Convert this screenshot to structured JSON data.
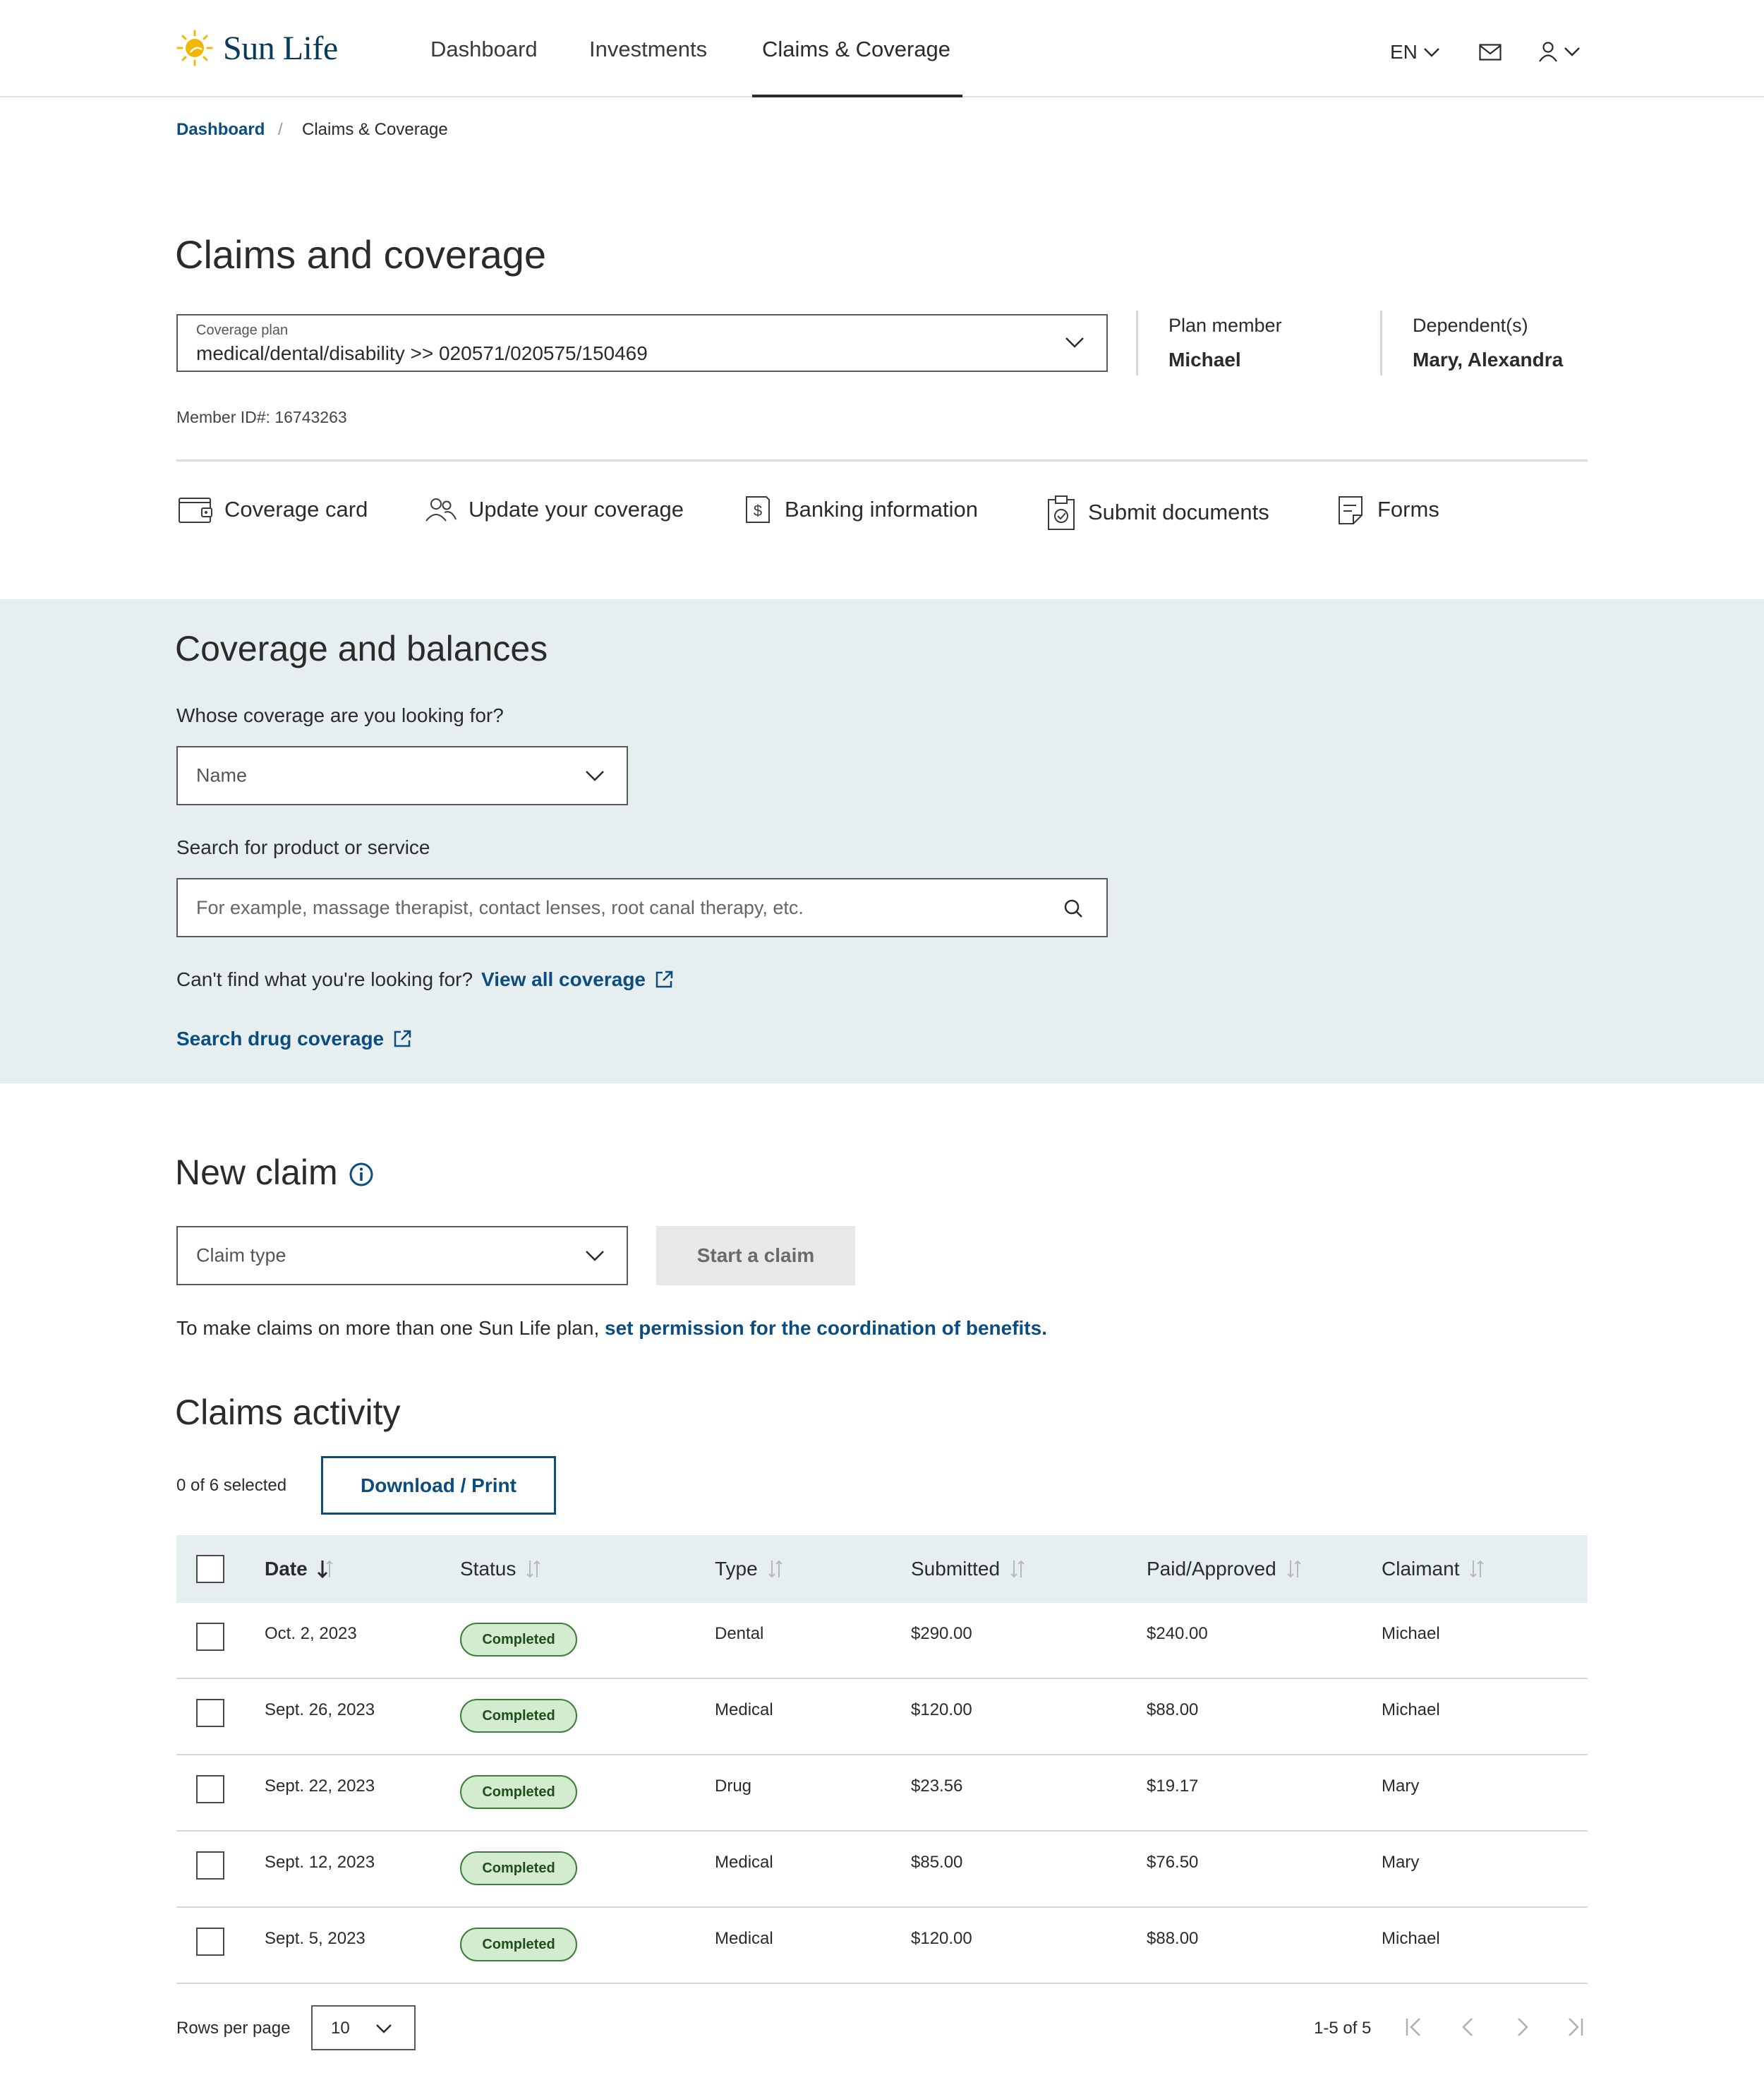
{
  "header": {
    "logo_text": "Sun Life",
    "nav": [
      "Dashboard",
      "Investments",
      "Claims & Coverage"
    ],
    "active_nav": "Claims & Coverage",
    "language": "EN"
  },
  "breadcrumb": {
    "parent": "Dashboard",
    "separator": "/",
    "current": "Claims & Coverage"
  },
  "page": {
    "title": "Claims and coverage",
    "coverage_plan_label": "Coverage plan",
    "coverage_plan_value": "medical/dental/disability >> 020571/020575/150469",
    "plan_member_label": "Plan member",
    "plan_member_value": "Michael",
    "dependents_label": "Dependent(s)",
    "dependents_value": "Mary, Alexandra",
    "member_id": "Member ID#: 16743263"
  },
  "quick_links": [
    {
      "label": "Coverage card",
      "icon": "wallet-card-icon"
    },
    {
      "label": "Update your coverage",
      "icon": "people-icon"
    },
    {
      "label": "Banking information",
      "icon": "dollar-document-icon"
    },
    {
      "label": "Submit documents",
      "icon": "clipboard-check-icon"
    },
    {
      "label": "Forms",
      "icon": "form-icon"
    }
  ],
  "coverage": {
    "title": "Coverage and balances",
    "whose_label": "Whose coverage are you looking for?",
    "name_select": "Name",
    "search_label": "Search for product or service",
    "search_placeholder": "For example, massage therapist, contact lenses, root canal therapy, etc.",
    "cant_find": "Can't find what you're looking for?",
    "view_all": "View all coverage",
    "drug_link": "Search drug coverage"
  },
  "new_claim": {
    "title": "New claim",
    "claim_type": "Claim type",
    "start_button": "Start a claim",
    "permission_text": "To make claims on more than one Sun Life plan,",
    "permission_link": "set permission for the coordination of benefits."
  },
  "claims_activity": {
    "title": "Claims activity",
    "selected_count": "0 of 6 selected",
    "download_button": "Download / Print",
    "columns": [
      "Date",
      "Status",
      "Type",
      "Submitted",
      "Paid/Approved",
      "Claimant"
    ],
    "rows": [
      {
        "date": "Oct. 2, 2023",
        "status": "Completed",
        "type": "Dental",
        "submitted": "$290.00",
        "paid": "$240.00",
        "claimant": "Michael"
      },
      {
        "date": "Sept. 26, 2023",
        "status": "Completed",
        "type": "Medical",
        "submitted": "$120.00",
        "paid": "$88.00",
        "claimant": "Michael"
      },
      {
        "date": "Sept. 22, 2023",
        "status": "Completed",
        "type": "Drug",
        "submitted": "$23.56",
        "paid": "$19.17",
        "claimant": "Mary"
      },
      {
        "date": "Sept. 12, 2023",
        "status": "Completed",
        "type": "Medical",
        "submitted": "$85.00",
        "paid": "$76.50",
        "claimant": "Mary"
      },
      {
        "date": "Sept. 5, 2023",
        "status": "Completed",
        "type": "Medical",
        "submitted": "$120.00",
        "paid": "$88.00",
        "claimant": "Michael"
      }
    ],
    "rows_per_page_label": "Rows per page",
    "rows_per_page_value": "10",
    "page_info": "1-5 of 5"
  },
  "colors": {
    "brand_blue": "#0b4d7e",
    "sun_yellow": "#f2b705",
    "section_bg": "#e6eeef",
    "badge_bg": "#d3ecd0"
  }
}
